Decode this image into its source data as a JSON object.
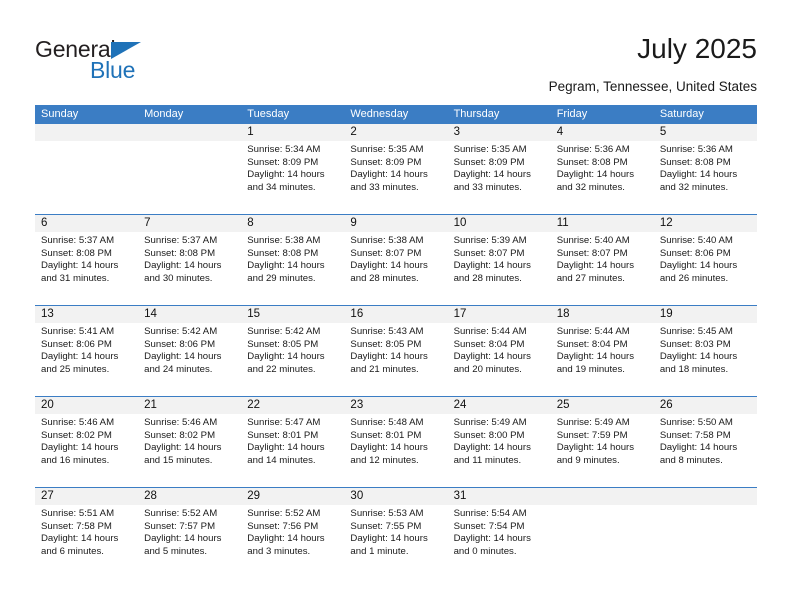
{
  "brand": {
    "name_part1": "General",
    "name_part2": "Blue",
    "accent_color": "#1f72b8"
  },
  "header": {
    "title": "July 2025",
    "subtitle": "Pegram, Tennessee, United States"
  },
  "calendar": {
    "header_color": "#3b7dc4",
    "day_band_color": "#f2f2f2",
    "weekdays": [
      "Sunday",
      "Monday",
      "Tuesday",
      "Wednesday",
      "Thursday",
      "Friday",
      "Saturday"
    ],
    "weeks": [
      [
        {
          "day": "",
          "empty": true,
          "sunrise": "",
          "sunset": "",
          "daylight1": "",
          "daylight2": ""
        },
        {
          "day": "",
          "empty": true,
          "sunrise": "",
          "sunset": "",
          "daylight1": "",
          "daylight2": ""
        },
        {
          "day": "1",
          "sunrise": "Sunrise: 5:34 AM",
          "sunset": "Sunset: 8:09 PM",
          "daylight1": "Daylight: 14 hours",
          "daylight2": "and 34 minutes."
        },
        {
          "day": "2",
          "sunrise": "Sunrise: 5:35 AM",
          "sunset": "Sunset: 8:09 PM",
          "daylight1": "Daylight: 14 hours",
          "daylight2": "and 33 minutes."
        },
        {
          "day": "3",
          "sunrise": "Sunrise: 5:35 AM",
          "sunset": "Sunset: 8:09 PM",
          "daylight1": "Daylight: 14 hours",
          "daylight2": "and 33 minutes."
        },
        {
          "day": "4",
          "sunrise": "Sunrise: 5:36 AM",
          "sunset": "Sunset: 8:08 PM",
          "daylight1": "Daylight: 14 hours",
          "daylight2": "and 32 minutes."
        },
        {
          "day": "5",
          "sunrise": "Sunrise: 5:36 AM",
          "sunset": "Sunset: 8:08 PM",
          "daylight1": "Daylight: 14 hours",
          "daylight2": "and 32 minutes."
        }
      ],
      [
        {
          "day": "6",
          "sunrise": "Sunrise: 5:37 AM",
          "sunset": "Sunset: 8:08 PM",
          "daylight1": "Daylight: 14 hours",
          "daylight2": "and 31 minutes."
        },
        {
          "day": "7",
          "sunrise": "Sunrise: 5:37 AM",
          "sunset": "Sunset: 8:08 PM",
          "daylight1": "Daylight: 14 hours",
          "daylight2": "and 30 minutes."
        },
        {
          "day": "8",
          "sunrise": "Sunrise: 5:38 AM",
          "sunset": "Sunset: 8:08 PM",
          "daylight1": "Daylight: 14 hours",
          "daylight2": "and 29 minutes."
        },
        {
          "day": "9",
          "sunrise": "Sunrise: 5:38 AM",
          "sunset": "Sunset: 8:07 PM",
          "daylight1": "Daylight: 14 hours",
          "daylight2": "and 28 minutes."
        },
        {
          "day": "10",
          "sunrise": "Sunrise: 5:39 AM",
          "sunset": "Sunset: 8:07 PM",
          "daylight1": "Daylight: 14 hours",
          "daylight2": "and 28 minutes."
        },
        {
          "day": "11",
          "sunrise": "Sunrise: 5:40 AM",
          "sunset": "Sunset: 8:07 PM",
          "daylight1": "Daylight: 14 hours",
          "daylight2": "and 27 minutes."
        },
        {
          "day": "12",
          "sunrise": "Sunrise: 5:40 AM",
          "sunset": "Sunset: 8:06 PM",
          "daylight1": "Daylight: 14 hours",
          "daylight2": "and 26 minutes."
        }
      ],
      [
        {
          "day": "13",
          "sunrise": "Sunrise: 5:41 AM",
          "sunset": "Sunset: 8:06 PM",
          "daylight1": "Daylight: 14 hours",
          "daylight2": "and 25 minutes."
        },
        {
          "day": "14",
          "sunrise": "Sunrise: 5:42 AM",
          "sunset": "Sunset: 8:06 PM",
          "daylight1": "Daylight: 14 hours",
          "daylight2": "and 24 minutes."
        },
        {
          "day": "15",
          "sunrise": "Sunrise: 5:42 AM",
          "sunset": "Sunset: 8:05 PM",
          "daylight1": "Daylight: 14 hours",
          "daylight2": "and 22 minutes."
        },
        {
          "day": "16",
          "sunrise": "Sunrise: 5:43 AM",
          "sunset": "Sunset: 8:05 PM",
          "daylight1": "Daylight: 14 hours",
          "daylight2": "and 21 minutes."
        },
        {
          "day": "17",
          "sunrise": "Sunrise: 5:44 AM",
          "sunset": "Sunset: 8:04 PM",
          "daylight1": "Daylight: 14 hours",
          "daylight2": "and 20 minutes."
        },
        {
          "day": "18",
          "sunrise": "Sunrise: 5:44 AM",
          "sunset": "Sunset: 8:04 PM",
          "daylight1": "Daylight: 14 hours",
          "daylight2": "and 19 minutes."
        },
        {
          "day": "19",
          "sunrise": "Sunrise: 5:45 AM",
          "sunset": "Sunset: 8:03 PM",
          "daylight1": "Daylight: 14 hours",
          "daylight2": "and 18 minutes."
        }
      ],
      [
        {
          "day": "20",
          "sunrise": "Sunrise: 5:46 AM",
          "sunset": "Sunset: 8:02 PM",
          "daylight1": "Daylight: 14 hours",
          "daylight2": "and 16 minutes."
        },
        {
          "day": "21",
          "sunrise": "Sunrise: 5:46 AM",
          "sunset": "Sunset: 8:02 PM",
          "daylight1": "Daylight: 14 hours",
          "daylight2": "and 15 minutes."
        },
        {
          "day": "22",
          "sunrise": "Sunrise: 5:47 AM",
          "sunset": "Sunset: 8:01 PM",
          "daylight1": "Daylight: 14 hours",
          "daylight2": "and 14 minutes."
        },
        {
          "day": "23",
          "sunrise": "Sunrise: 5:48 AM",
          "sunset": "Sunset: 8:01 PM",
          "daylight1": "Daylight: 14 hours",
          "daylight2": "and 12 minutes."
        },
        {
          "day": "24",
          "sunrise": "Sunrise: 5:49 AM",
          "sunset": "Sunset: 8:00 PM",
          "daylight1": "Daylight: 14 hours",
          "daylight2": "and 11 minutes."
        },
        {
          "day": "25",
          "sunrise": "Sunrise: 5:49 AM",
          "sunset": "Sunset: 7:59 PM",
          "daylight1": "Daylight: 14 hours",
          "daylight2": "and 9 minutes."
        },
        {
          "day": "26",
          "sunrise": "Sunrise: 5:50 AM",
          "sunset": "Sunset: 7:58 PM",
          "daylight1": "Daylight: 14 hours",
          "daylight2": "and 8 minutes."
        }
      ],
      [
        {
          "day": "27",
          "sunrise": "Sunrise: 5:51 AM",
          "sunset": "Sunset: 7:58 PM",
          "daylight1": "Daylight: 14 hours",
          "daylight2": "and 6 minutes."
        },
        {
          "day": "28",
          "sunrise": "Sunrise: 5:52 AM",
          "sunset": "Sunset: 7:57 PM",
          "daylight1": "Daylight: 14 hours",
          "daylight2": "and 5 minutes."
        },
        {
          "day": "29",
          "sunrise": "Sunrise: 5:52 AM",
          "sunset": "Sunset: 7:56 PM",
          "daylight1": "Daylight: 14 hours",
          "daylight2": "and 3 minutes."
        },
        {
          "day": "30",
          "sunrise": "Sunrise: 5:53 AM",
          "sunset": "Sunset: 7:55 PM",
          "daylight1": "Daylight: 14 hours",
          "daylight2": "and 1 minute."
        },
        {
          "day": "31",
          "sunrise": "Sunrise: 5:54 AM",
          "sunset": "Sunset: 7:54 PM",
          "daylight1": "Daylight: 14 hours",
          "daylight2": "and 0 minutes."
        },
        {
          "day": "",
          "empty": true,
          "sunrise": "",
          "sunset": "",
          "daylight1": "",
          "daylight2": ""
        },
        {
          "day": "",
          "empty": true,
          "sunrise": "",
          "sunset": "",
          "daylight1": "",
          "daylight2": ""
        }
      ]
    ]
  }
}
